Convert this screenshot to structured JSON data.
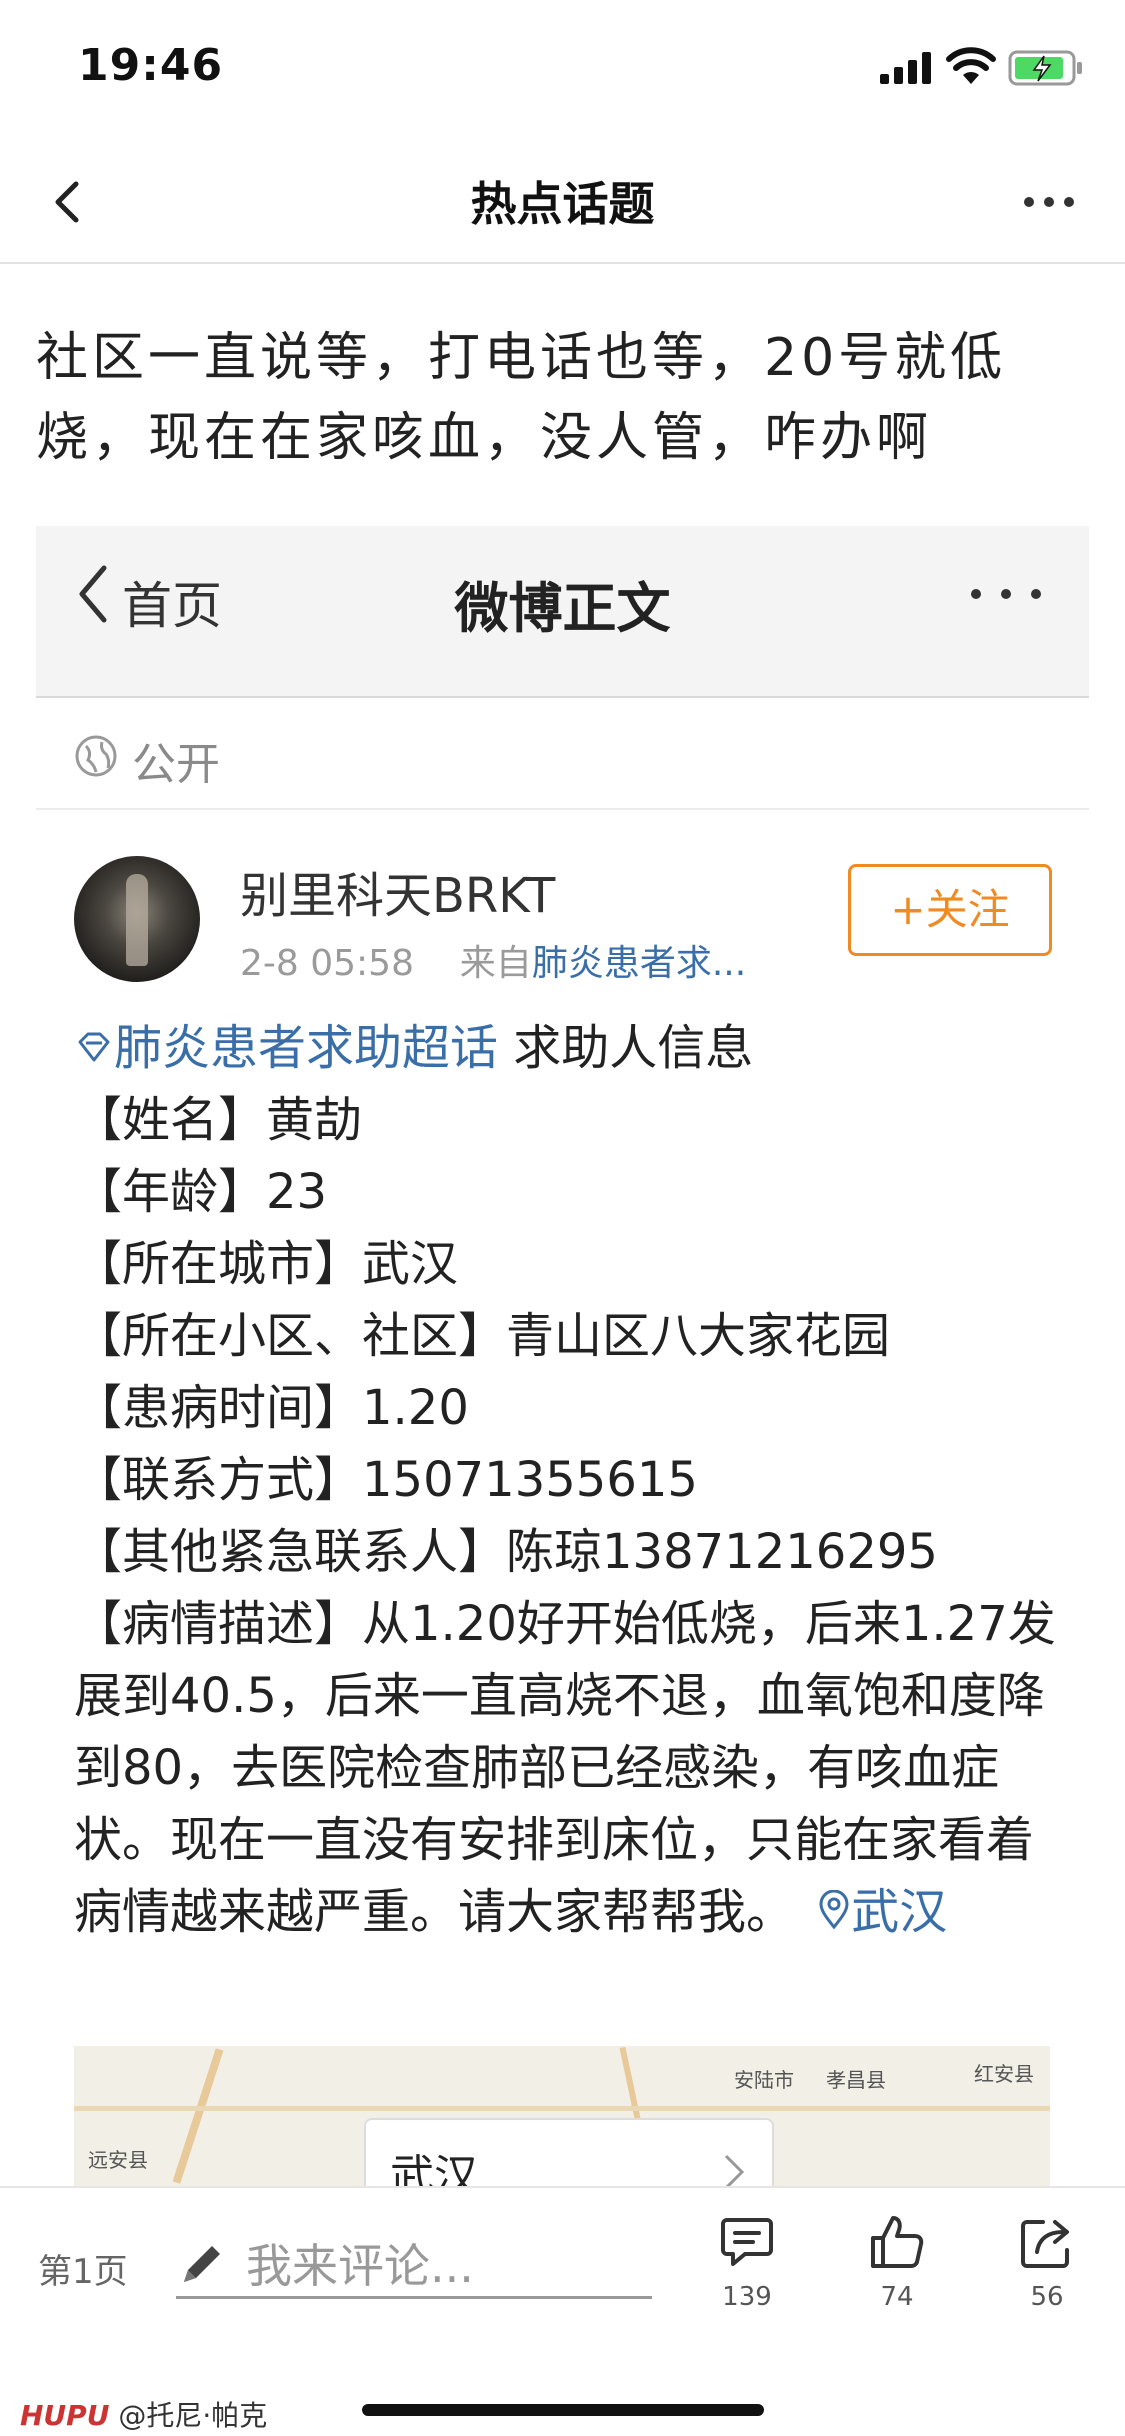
{
  "status_bar": {
    "time": "19:46"
  },
  "nav": {
    "title": "热点话题"
  },
  "post": {
    "text": "社区一直说等，打电话也等，20号就低烧，现在在家咳血，没人管，咋办啊"
  },
  "weibo": {
    "back_label": "首页",
    "title": "微博正文",
    "visibility": "公开",
    "user": {
      "name": "别里科天BRKT",
      "time": "2-8 05:58",
      "source_prefix": "来自",
      "source": "肺炎患者求..."
    },
    "follow_label": "+关注",
    "tag": "肺炎患者求助超话",
    "heading": "求助人信息",
    "lines": [
      "【姓名】黄劼",
      "【年龄】23",
      "【所在城市】武汉",
      "【所在小区、社区】青山区八大家花园",
      "【患病时间】1.20",
      "【联系方式】15071355615",
      "【其他紧急联系人】陈琼13871216295"
    ],
    "description": "【病情描述】从1.20好开始低烧，后来1.27发展到40.5，后来一直高烧不退，血氧饱和度降到80，去医院检查肺部已经感染，有咳血症状。现在一直没有安排到床位，只能在家看着病情越来越严重。请大家帮帮我。",
    "location": "武汉",
    "map": {
      "places": [
        "安陆市",
        "孝昌县",
        "红安县",
        "远安县"
      ],
      "card_label": "武汉"
    }
  },
  "bottom_bar": {
    "page": "第1页",
    "comment_placeholder": "我来评论...",
    "comments": "139",
    "likes": "74",
    "shares": "56"
  },
  "watermark": {
    "brand": "HUPU",
    "author": "@托尼·帕克"
  },
  "colors": {
    "link": "#3a6ea8",
    "follow": "#f08a24",
    "battery": "#4cd964"
  }
}
